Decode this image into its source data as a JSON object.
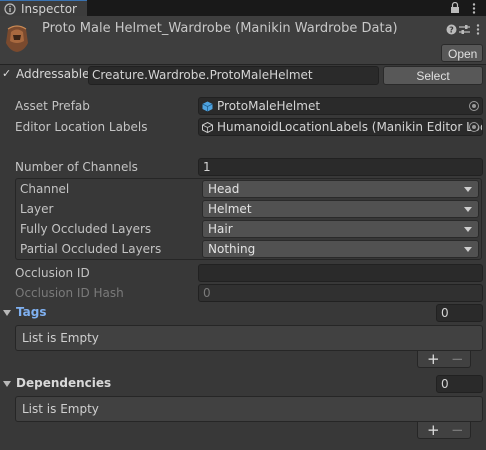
{
  "window": {
    "tab_label": "Inspector",
    "tab_icon": "info-icon",
    "lock_icon": "lock-icon",
    "menu_icon": "kebab-menu-icon"
  },
  "header": {
    "title": "Proto Male Helmet_Wardrobe (Manikin Wardrobe Data)",
    "asset_icon": "helmet-thumbnail-icon",
    "help_icon": "help-icon",
    "settings_icon": "preset-settings-icon",
    "menu_icon": "kebab-menu-icon",
    "open_label": "Open"
  },
  "addressable": {
    "checked": true,
    "label": "Addressable",
    "value": "Creature.Wardrobe.ProtoMaleHelmet",
    "select_label": "Select"
  },
  "fields": {
    "asset_prefab_label": "Asset Prefab",
    "asset_prefab_value": "ProtoMaleHelmet",
    "editor_location_label": "Editor Location Labels",
    "editor_location_value": "HumanoidLocationLabels (Manikin Editor Loc",
    "num_channels_label": "Number of Channels",
    "num_channels_value": "1"
  },
  "channel_group": {
    "channel_label": "Channel",
    "channel_value": "Head",
    "layer_label": "Layer",
    "layer_value": "Helmet",
    "fully_label": "Fully Occluded Layers",
    "fully_value": "Hair",
    "partial_label": "Partial Occluded Layers",
    "partial_value": "Nothing"
  },
  "occlusion": {
    "id_label": "Occlusion ID",
    "id_value": "",
    "hash_label": "Occlusion ID Hash",
    "hash_value": "0"
  },
  "tags": {
    "label": "Tags",
    "count": "0",
    "empty_text": "List is Empty",
    "add_label": "+",
    "remove_label": "−"
  },
  "dependencies": {
    "label": "Dependencies",
    "count": "0",
    "empty_text": "List is Empty",
    "add_label": "+",
    "remove_label": "−"
  },
  "colors": {
    "background": "#383838",
    "tags_accent": "#7fb0f0",
    "field_bg": "#2a2a2a",
    "dropdown_bg": "#515151"
  }
}
